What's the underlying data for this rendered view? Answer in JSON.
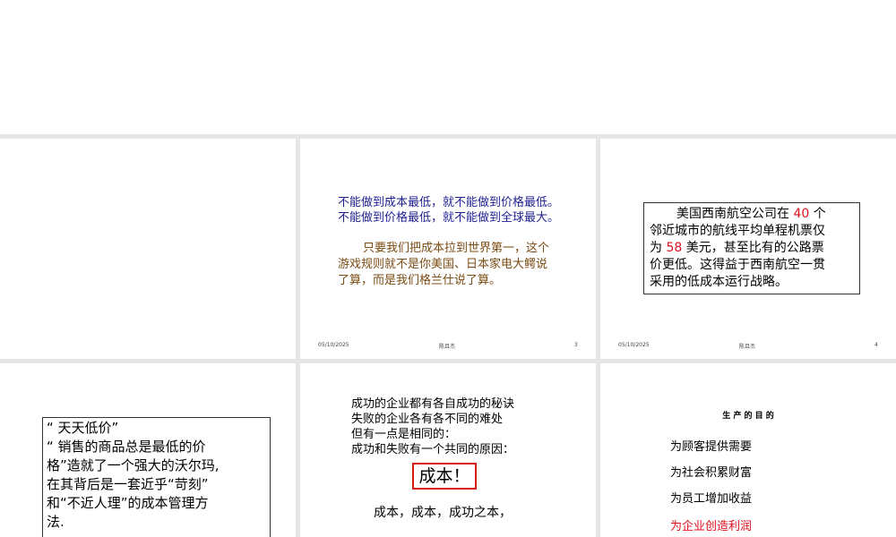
{
  "slide3": {
    "line1": "不能做到成本最低，就不能做到价格最低。",
    "line2": "不能做到价格最低，就不能做到全球最大。",
    "para": [
      "只要我们把成本拉到世界第一，这个",
      "游戏规则就不是你美国、日本家电大鳄说",
      "了算，而是我们格兰仕说了算。"
    ],
    "date": "05/10/2025",
    "author": "陈且杰",
    "page": "3"
  },
  "slide4": {
    "l1_a": "美国西南航空公司在 ",
    "l1_num": "40",
    "l1_b": " 个",
    "l2": "邻近城市的航线平均单程机票仅",
    "l3_a": "为 ",
    "l3_num": "58",
    "l3_b": " 美元，甚至比有的公路票",
    "l4": "价更低。这得益于西南航空一贯",
    "l5": "采用的低成本运行战略。",
    "date": "05/10/2025",
    "author": "陈且杰",
    "page": "4"
  },
  "slide5": {
    "lines": [
      "“ 天天低价”",
      "“ 销售的商品总是最低的价",
      "格”造就了一个强大的沃尔玛,",
      "在其背后是一套近乎“苛刻”",
      "和“不近人理”的成本管理方",
      "法."
    ]
  },
  "slide6": {
    "lines": [
      "成功的企业都有各自成功的秘诀",
      "失败的企业各有各不同的难处",
      "但有一点是相同的：",
      "成功和失败有一个共同的原因："
    ],
    "highlight": "成本！",
    "bottom": "成本，成本，成功之本，"
  },
  "slide7": {
    "title": "生 产 的 目 的",
    "items": [
      "为顾客提供需要",
      "为社会积累财富",
      "为员工增加收益"
    ],
    "highlight": "为企业创造利润"
  }
}
